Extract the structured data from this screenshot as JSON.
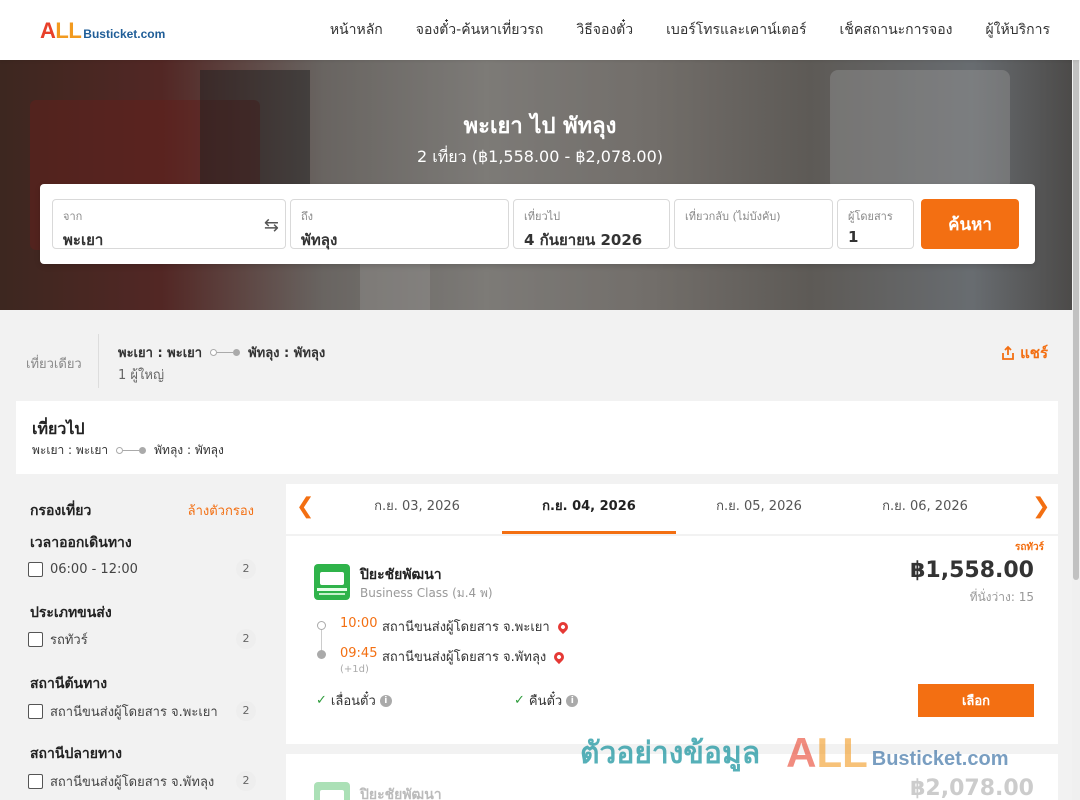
{
  "brand": {
    "all": "ALL",
    "all_a": "A",
    "all_ll": "LL",
    "rest": "Busticket.com"
  },
  "nav": [
    "หน้าหลัก",
    "จองตั๋ว-ค้นหาเที่ยวรถ",
    "วิธีจองตั๋ว",
    "เบอร์โทรและเคาน์เตอร์",
    "เช็คสถานะการจอง",
    "ผู้ให้บริการ"
  ],
  "hero": {
    "title": "พะเยา ไป พัทลุง",
    "subtitle": "2 เที่ยว (฿1,558.00 - ฿2,078.00)"
  },
  "search": {
    "from_label": "จาก",
    "from_value": "พะเยา",
    "to_label": "ถึง",
    "to_value": "พัทลุง",
    "depart_label": "เที่ยวไป",
    "depart_value": "4 กันยายน 2026",
    "return_label": "เที่ยวกลับ (ไม่บังคับ)",
    "return_value": "",
    "pax_label": "ผู้โดยสาร",
    "pax_value": "1",
    "button": "ค้นหา"
  },
  "summary": {
    "trip_type": "เที่ยวเดียว",
    "from": "พะเยา : พะเยา",
    "to": "พัทลุง : พัทลุง",
    "pax": "1 ผู้ใหญ่",
    "share": "แชร์"
  },
  "outbound": {
    "title": "เที่ยวไป",
    "from": "พะเยา : พะเยา",
    "to": "พัทลุง : พัทลุง"
  },
  "filters": {
    "title": "กรองเที่ยว",
    "clear": "ล้างตัวกรอง",
    "sections": [
      {
        "title": "เวลาออกเดินทาง",
        "option": "06:00 - 12:00",
        "count": "2"
      },
      {
        "title": "ประเภทขนส่ง",
        "option": "รถทัวร์",
        "count": "2"
      },
      {
        "title": "สถานีต้นทาง",
        "option": "สถานีขนส่งผู้โดยสาร จ.พะเยา",
        "count": "2"
      },
      {
        "title": "สถานีปลายทาง",
        "option": "สถานีขนส่งผู้โดยสาร จ.พัทลุง",
        "count": "2"
      }
    ]
  },
  "dates": {
    "tabs": [
      "ก.ย. 03, 2026",
      "ก.ย. 04, 2026",
      "ก.ย. 05, 2026",
      "ก.ย. 06, 2026"
    ],
    "active_index": 1
  },
  "results": [
    {
      "tag": "รถทัวร์",
      "operator": "ปิยะชัยพัฒนา",
      "class": "Business Class (ม.4 พ)",
      "price": "฿1,558.00",
      "seats": "ที่นั่งว่าง: 15",
      "depart_time": "10:00",
      "depart_station": "สถานีขนส่งผู้โดยสาร จ.พะเยา",
      "arrive_time": "09:45",
      "arrive_station": "สถานีขนส่งผู้โดยสาร จ.พัทลุง",
      "next_day": "(+1d)",
      "feature_1": "เลื่อนตั๋ว",
      "feature_2": "คืนตั๋ว",
      "select": "เลือก"
    },
    {
      "operator": "ปิยะชัยพัฒนา",
      "price": "฿2,078.00"
    }
  ],
  "watermark": {
    "text": "ตัวอย่างข้อมูล",
    "all_a": "A",
    "all_ll": "LL",
    "rest": "Busticket.com"
  },
  "colors": {
    "accent": "#f36f12",
    "brand_red": "#e8402a",
    "brand_orange": "#f29a1f",
    "brand_blue": "#1f5d97"
  }
}
